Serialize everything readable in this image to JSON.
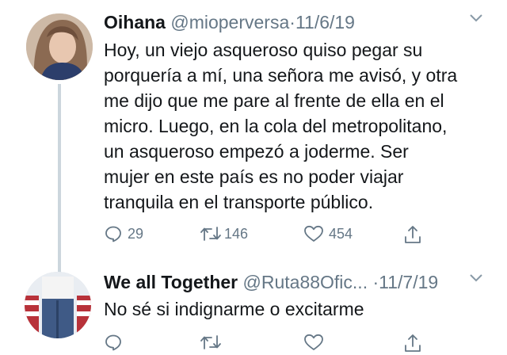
{
  "tweets": [
    {
      "name": "Oihana",
      "handle": "@mioperversa",
      "separator": "·",
      "date": "11/6/19",
      "text_lines": [
        "Hoy, un viejo asqueroso quiso pegar su",
        "porquería a mí, una señora me avisó, y otra",
        "me dijo que me pare al frente de ella en el",
        "micro. Luego, en la cola del metropolitano,",
        "un asqueroso empezó a joderme. Ser",
        "mujer en este país es no poder viajar",
        "tranquila en el transporte público."
      ],
      "replies": "29",
      "retweets": "146",
      "likes": "454"
    },
    {
      "name": "We all Together",
      "handle": "@Ruta88Ofic...",
      "separator": "·",
      "date": "11/7/19",
      "text": "No sé si indignarme o excitarme"
    }
  ],
  "icons": {
    "reply": "reply-icon",
    "retweet": "retweet-icon",
    "like": "heart-icon",
    "share": "share-icon",
    "more": "chevron-down-icon"
  },
  "colors": {
    "text": "#14171a",
    "secondary": "#657786",
    "thread_line": "#ccd6dd"
  }
}
